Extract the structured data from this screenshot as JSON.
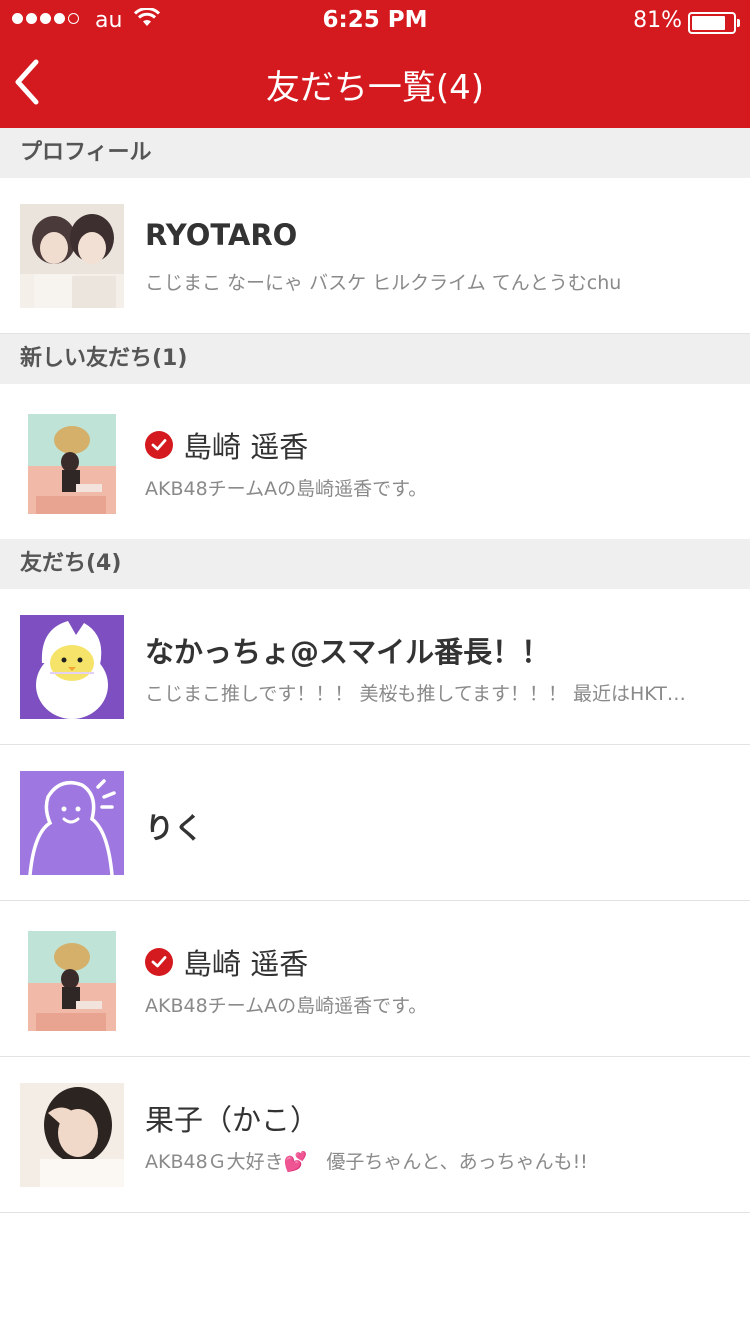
{
  "status_bar": {
    "carrier": "au",
    "time": "6:25 PM",
    "battery": "81%"
  },
  "nav": {
    "title": "友だち一覧(4)"
  },
  "sections": {
    "profile": "プロフィール",
    "new_friends": "新しい友だち(1)",
    "friends": "友だち(4)"
  },
  "profile": {
    "name": "RYOTARO",
    "status": "こじまこ なーにゃ バスケ ヒルクライム てんとうむchu"
  },
  "new_friends": [
    {
      "name": "島崎 遥香",
      "status": "AKB48チームAの島崎遥香です。",
      "verified": true
    }
  ],
  "friends": [
    {
      "name": "なかっちょ@スマイル番長！！",
      "status": "こじまこ推しです！！！ 美桜も推してます！！！ 最近はHKT…",
      "verified": false
    },
    {
      "name": "りく",
      "status": "",
      "verified": false
    },
    {
      "name": "島崎 遥香",
      "status": "AKB48チームAの島崎遥香です。",
      "verified": true
    },
    {
      "name": "果子（かこ）",
      "status": "AKB48Ｇ大好き💕　優子ちゃんと、あっちゃんも!!",
      "verified": false
    }
  ],
  "colors": {
    "accent": "#d41a1f",
    "section_bg": "#efeff0",
    "name_text": "#333333",
    "sub_text": "#8a8a8a"
  }
}
